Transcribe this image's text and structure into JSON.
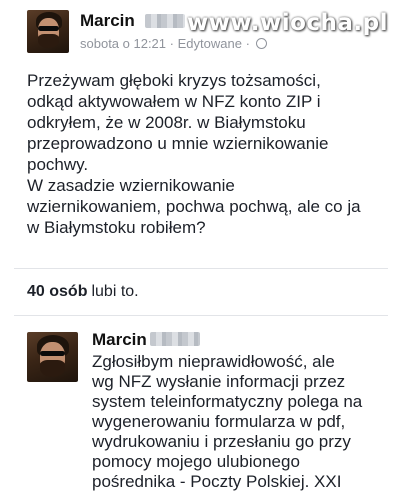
{
  "watermark": "www.wiocha.pl",
  "post": {
    "author_name": "Marcin",
    "timestamp": "sobota o 12:21",
    "separator": "·",
    "edited_label": "Edytowane",
    "separator2": "·",
    "icon": "globe-icon",
    "text": "Przeżywam głęboki kryzys tożsamości,\nodkąd aktywowałem w NFZ konto ZIP i\nodkryłem, że w 2008r. w Białymstoku\nprzeprowadzono u mnie wziernikowanie\npochwy.\nW zasadzie wziernikowanie\nwziernikowaniem, pochwa pochwą, ale co ja\nw Białymstoku robiłem?"
  },
  "likes": {
    "count": "40 osób",
    "suffix": "lubi to."
  },
  "comment": {
    "author_name": "Marcin",
    "text": "Zgłosiłbym nieprawidłowość, ale\nwg NFZ wysłanie informacji przez\nsystem teleinformatyczny polega na\nwygenerowaniu formularza w pdf,\nwydrukowaniu i przesłaniu go przy\npomocy mojego ulubionego\npośrednika - Poczty Polskiej. XXI"
  },
  "colors": {
    "text": "#1d2129",
    "meta": "#90949c",
    "divider": "#e2e4e8"
  }
}
